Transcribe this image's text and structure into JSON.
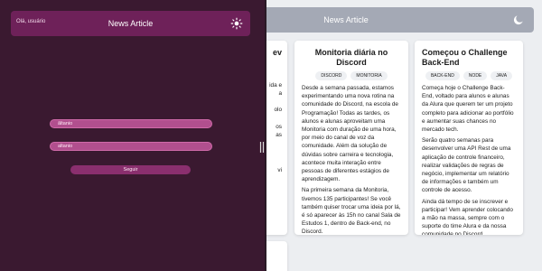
{
  "background": {
    "header_title": "News Article",
    "cards": {
      "left": {
        "title_fragment": "ev",
        "lines": [
          "ida e",
          "a",
          "olo",
          "os",
          "as",
          "vi"
        ]
      },
      "middle": {
        "title": "Monitoria diária no Discord",
        "tags": [
          "DISCORD",
          "MONITORIA"
        ],
        "paragraphs": [
          "Desde a semana passada, estamos experimentando uma nova rotina na comunidade do Discord, na escola de Programação! Todas as tardes, os alunos e alunas aproveitam uma Monitoria com duração de uma hora, por meio do canal de voz da comunidade. Além da solução de dúvidas sobre carreira e tecnologia, acontece muita interação entre pessoas de diferentes estágios de aprendizagem.",
          "Na primeira semana da Monitoria, tivemos 135 participantes! Se você também quiser trocar uma ideia por lá, é só aparecer às 15h no canal Sala de Estudos 1, dentro de Back-end, no Discord."
        ]
      },
      "right": {
        "title": "Começou o Challenge Back-End",
        "tags": [
          "BACK-END",
          "NODE",
          "JAVA"
        ],
        "paragraphs": [
          "Começa hoje o Challenge Back-End, voltado para alunos e alunas da Alura que querem ter um projeto completo para adicionar ao portfólio e aumentar suas chances no mercado tech.",
          "Serão quatro semanas para desenvolver uma API Rest de uma aplicação de controle financeiro, realizar validações de regras de negócio, implementar um relatório de informações e também um controle de acesso.",
          "Ainda dá tempo de se inscrever e participar! Vem aprender colocando a mão na massa, sempre com o suporte do time Alura e da nossa comunidade no Discord."
        ]
      }
    },
    "icons": {
      "theme_toggle": "moon-icon"
    }
  },
  "panel": {
    "greeting": "Olá, usuário",
    "title": "News Article",
    "icons": {
      "theme_toggle": "sun-icon"
    },
    "login": {
      "username_value": "âltanio",
      "password_value": "altanio",
      "submit_label": "Seguir"
    }
  }
}
